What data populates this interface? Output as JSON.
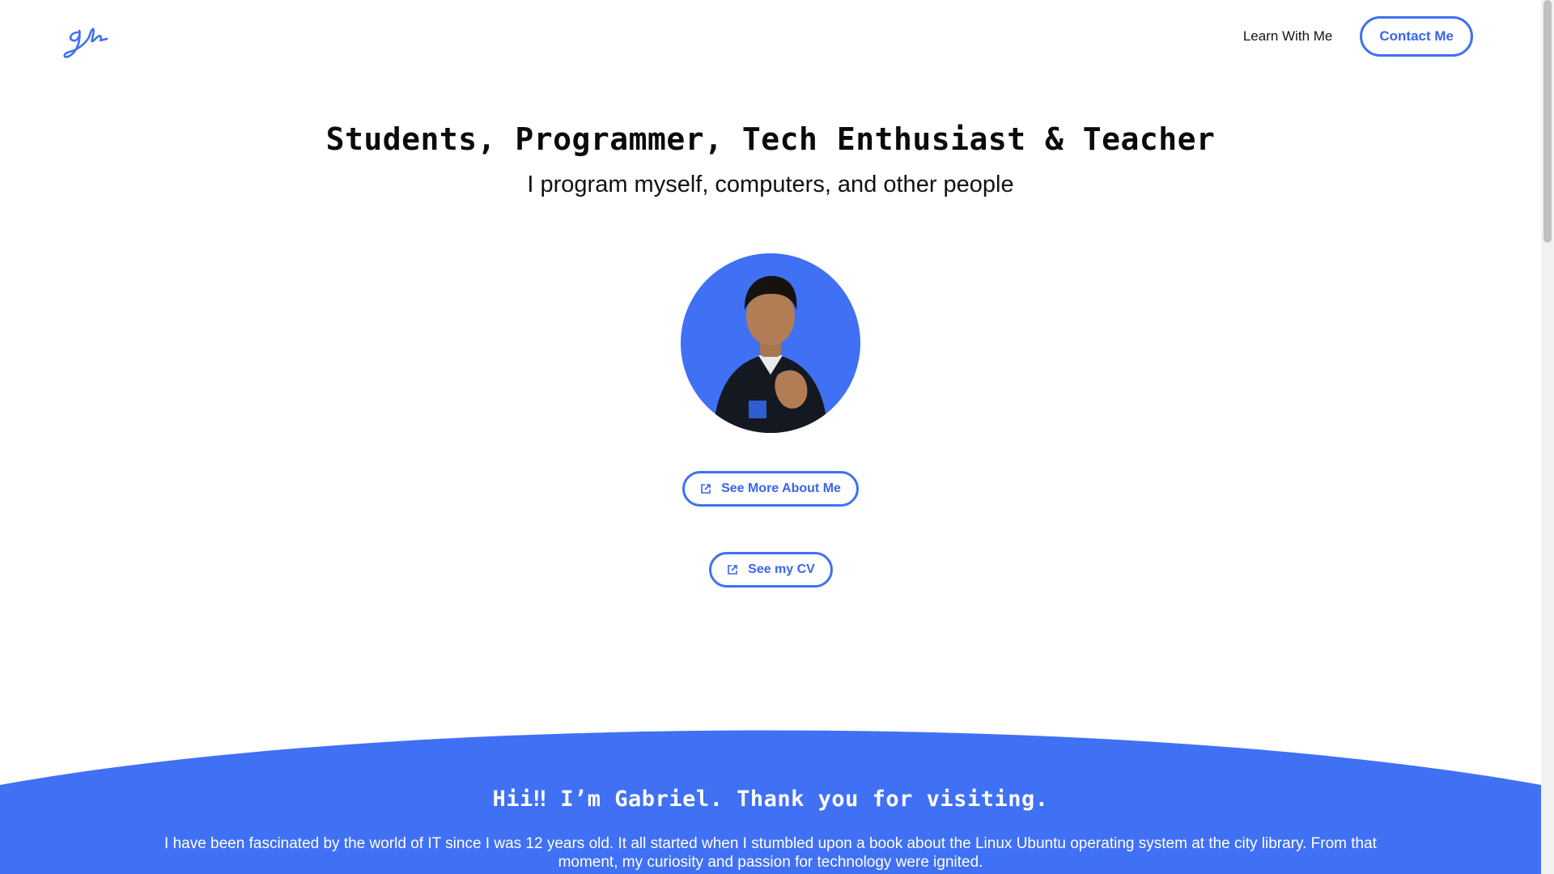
{
  "header": {
    "logo_text": "gh",
    "nav": {
      "learn_label": "Learn With Me",
      "contact_label": "Contact Me"
    }
  },
  "hero": {
    "headline": "Students, Programmer, Tech Enthusiast & Teacher",
    "subhead": "I program myself, computers, and other people",
    "buttons": {
      "about_label": "See More About Me",
      "cv_label": "See my CV"
    }
  },
  "intro": {
    "title": "Hii‼ I’m Gabriel. Thank you for visiting.",
    "body": "I have been fascinated by the world of IT since I was 12 years old. It all started when I stumbled upon a book about the Linux Ubuntu operating system at the city library. From that moment, my curiosity and passion for technology were ignited."
  },
  "icons": {
    "logo": "signature-logo-icon",
    "external": "external-link-icon"
  },
  "colors": {
    "accent": "#4070f4",
    "text": "#111111",
    "background": "#ffffff"
  }
}
